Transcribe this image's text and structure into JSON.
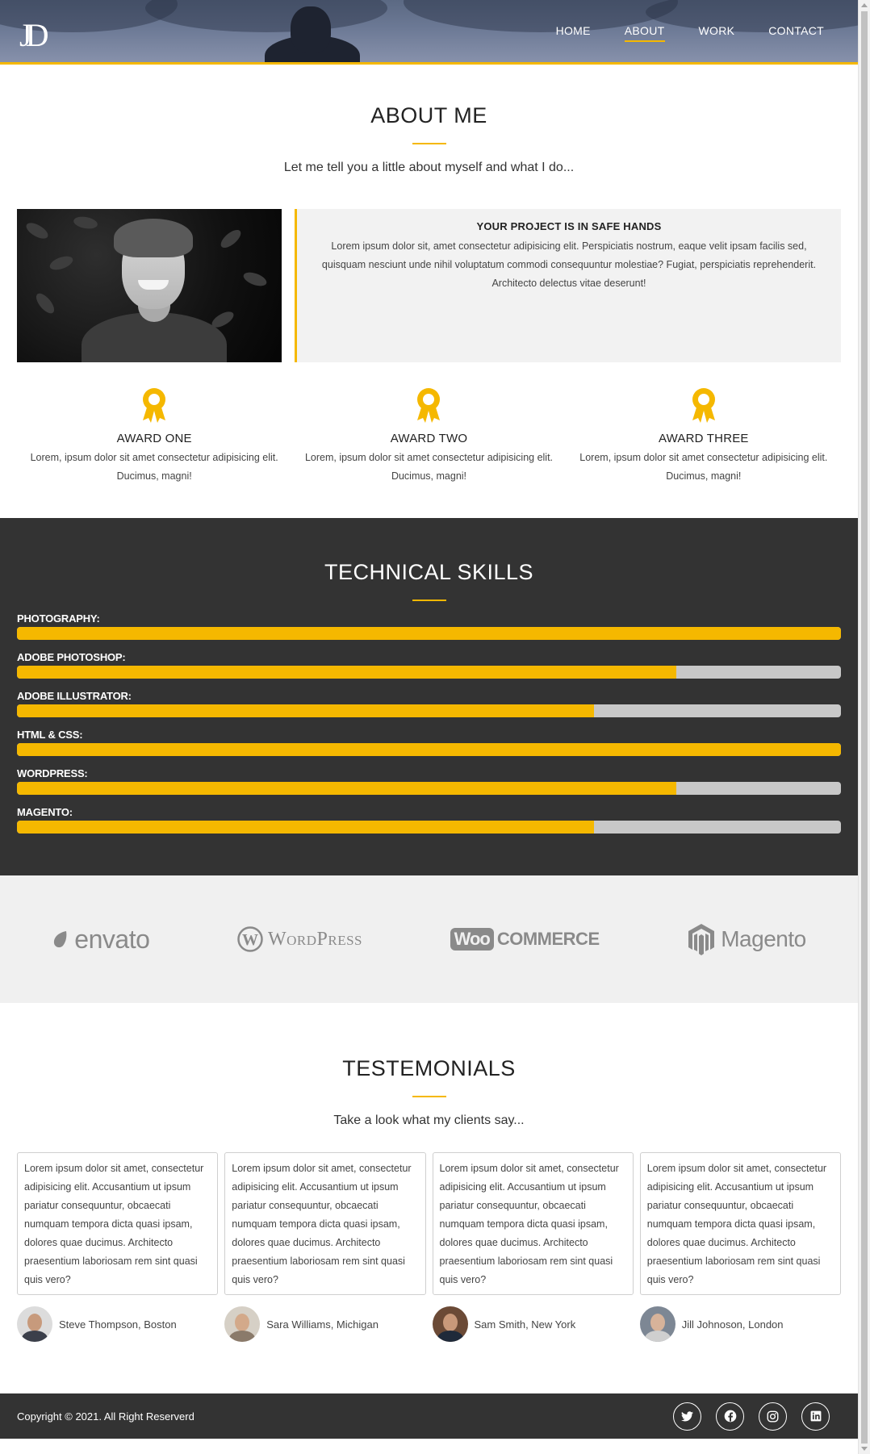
{
  "header": {
    "logo": "JD",
    "nav": [
      {
        "label": "HOME",
        "active": false
      },
      {
        "label": "ABOUT",
        "active": true
      },
      {
        "label": "WORK",
        "active": false
      },
      {
        "label": "CONTACT",
        "active": false
      }
    ]
  },
  "about": {
    "title": "ABOUT ME",
    "subtitle": "Let me tell you a little about myself and what I do...",
    "card_title": "YOUR PROJECT IS IN SAFE HANDS",
    "card_text": "Lorem ipsum dolor sit, amet consectetur adipisicing elit. Perspiciatis nostrum, eaque velit ipsam facilis sed, quisquam nesciunt unde nihil voluptatum commodi consequuntur molestiae? Fugiat, perspiciatis reprehenderit. Architecto delectus vitae deserunt!",
    "awards": [
      {
        "title": "AWARD ONE",
        "text": "Lorem, ipsum dolor sit amet consectetur adipisicing elit. Ducimus, magni!",
        "icon": "award-ribbon-icon"
      },
      {
        "title": "AWARD TWO",
        "text": "Lorem, ipsum dolor sit amet consectetur adipisicing elit. Ducimus, magni!",
        "icon": "award-ribbon-icon"
      },
      {
        "title": "AWARD THREE",
        "text": "Lorem, ipsum dolor sit amet consectetur adipisicing elit. Ducimus, magni!",
        "icon": "award-ribbon-icon"
      }
    ]
  },
  "skills": {
    "title": "TECHNICAL SKILLS",
    "items": [
      {
        "label": "PHOTOGRAPHY:",
        "level": 100
      },
      {
        "label": "ADOBE PHOTOSHOP:",
        "level": 80
      },
      {
        "label": "ADOBE ILLUSTRATOR:",
        "level": 70
      },
      {
        "label": "HTML & CSS:",
        "level": 100
      },
      {
        "label": "WORDPRESS:",
        "level": 80
      },
      {
        "label": "MAGENTO:",
        "level": 70
      }
    ]
  },
  "partners": [
    {
      "name": "envato",
      "icon": "envato-leaf-icon"
    },
    {
      "name": "WordPress",
      "icon": "wordpress-logo-icon"
    },
    {
      "name": "COMMERCE",
      "badge": "Woo",
      "icon": "woocommerce-logo-icon"
    },
    {
      "name": "Magento",
      "icon": "magento-logo-icon"
    }
  ],
  "testimonials": {
    "title": "TESTEMONIALS",
    "subtitle": "Take a look what my clients say...",
    "items": [
      {
        "text": "Lorem ipsum dolor sit amet, consectetur adipisicing elit. Accusantium ut ipsum pariatur consequuntur, obcaecati numquam tempora dicta quasi ipsam, dolores quae ducimus. Architecto praesentium laboriosam rem sint quasi quis vero?",
        "name": "Steve Thompson, Boston"
      },
      {
        "text": "Lorem ipsum dolor sit amet, consectetur adipisicing elit. Accusantium ut ipsum pariatur consequuntur, obcaecati numquam tempora dicta quasi ipsam, dolores quae ducimus. Architecto praesentium laboriosam rem sint quasi quis vero?",
        "name": "Sara Williams, Michigan"
      },
      {
        "text": "Lorem ipsum dolor sit amet, consectetur adipisicing elit. Accusantium ut ipsum pariatur consequuntur, obcaecati numquam tempora dicta quasi ipsam, dolores quae ducimus. Architecto praesentium laboriosam rem sint quasi quis vero?",
        "name": "Sam Smith, New York"
      },
      {
        "text": "Lorem ipsum dolor sit amet, consectetur adipisicing elit. Accusantium ut ipsum pariatur consequuntur, obcaecati numquam tempora dicta quasi ipsam, dolores quae ducimus. Architecto praesentium laboriosam rem sint quasi quis vero?",
        "name": "Jill Johnoson, London"
      }
    ]
  },
  "footer": {
    "copyright": "Copyright © 2021. All Right Reserverd",
    "socials": [
      "twitter-icon",
      "facebook-icon",
      "instagram-icon",
      "linkedin-icon"
    ]
  },
  "colors": {
    "accent": "#f5b800",
    "dark": "#333333",
    "light_bg": "#f2f2f2"
  }
}
